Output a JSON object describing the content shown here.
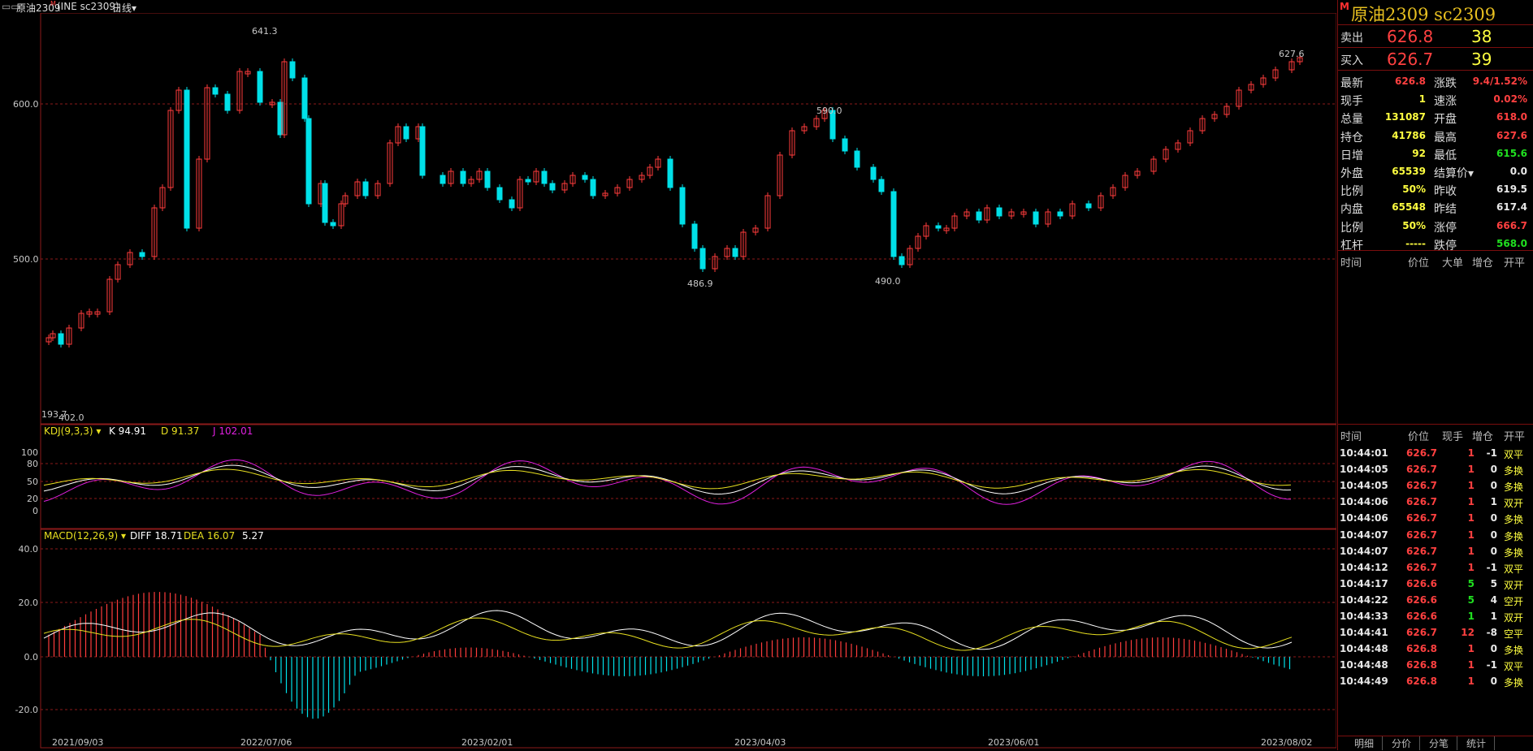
{
  "topbar": {
    "title": "原油2309",
    "exchange": "(INE sc2309)",
    "period": "日线",
    "period_arrow": "▾"
  },
  "main_chart": {
    "y_labels": [
      "600.0",
      "500.0"
    ],
    "annotations": {
      "high": "641.3",
      "mid_high": "590.0",
      "last_high": "627.6",
      "low1": "486.9",
      "low2": "490.0",
      "start_low": "193.7",
      "start_low2": "402.0"
    },
    "x_labels": [
      "2021/09/03",
      "2022/07/06",
      "2023/02/01",
      "2023/04/03",
      "2023/06/01",
      "2023/08/02"
    ]
  },
  "kdj": {
    "name": "KDJ(9,3,3)",
    "k": "K 94.91",
    "d": "D 91.37",
    "j": "J 102.01",
    "y_labels": [
      "100",
      "80",
      "50",
      "20",
      "0"
    ]
  },
  "macd": {
    "name": "MACD(12,26,9)",
    "diff": "DIFF 18.71",
    "dea": "DEA 16.07",
    "macd": "5.27",
    "y_labels": [
      "40.0",
      "20.0",
      "0.0",
      "-20.0"
    ]
  },
  "colors": {
    "up": "#ff3c3c",
    "down": "#00e0e8",
    "grid": "#8b1a1a",
    "k": "#ffffff",
    "d": "#e8e020",
    "j": "#e020e0"
  },
  "side": {
    "marker": "M",
    "title": "原油2309  sc2309",
    "sell": {
      "label": "卖出",
      "price": "626.8",
      "vol": "38"
    },
    "buy": {
      "label": "买入",
      "price": "626.7",
      "vol": "39"
    },
    "quote_rows": [
      {
        "l1": "最新",
        "v1": "626.8",
        "c1": "red",
        "l2": "涨跌",
        "v2": "9.4/1.52%",
        "c2": "red"
      },
      {
        "l1": "现手",
        "v1": "1",
        "c1": "yellow",
        "l2": "速涨",
        "v2": "0.02%",
        "c2": "red"
      },
      {
        "l1": "总量",
        "v1": "131087",
        "c1": "yellow",
        "l2": "开盘",
        "v2": "618.0",
        "c2": "red"
      },
      {
        "l1": "持仓",
        "v1": "41786",
        "c1": "yellow",
        "l2": "最高",
        "v2": "627.6",
        "c2": "red"
      },
      {
        "l1": "日增",
        "v1": "92",
        "c1": "yellow",
        "l2": "最低",
        "v2": "615.6",
        "c2": "green"
      },
      {
        "l1": "外盘",
        "v1": "65539",
        "c1": "yellow",
        "l2": "结算价▾",
        "v2": "0.0",
        "c2": "white"
      },
      {
        "l1": "比例",
        "v1": "50%",
        "c1": "yellow",
        "l2": "昨收",
        "v2": "619.5",
        "c2": "white"
      },
      {
        "l1": "内盘",
        "v1": "65548",
        "c1": "yellow",
        "l2": "昨结",
        "v2": "617.4",
        "c2": "white"
      },
      {
        "l1": "比例",
        "v1": "50%",
        "c1": "yellow",
        "l2": "涨停",
        "v2": "666.7",
        "c2": "red"
      },
      {
        "l1": "杠杆",
        "v1": "-----",
        "c1": "yellow",
        "l2": "跌停",
        "v2": "568.0",
        "c2": "green"
      }
    ],
    "big_header": [
      "时间",
      "价位",
      "大单",
      "增仓",
      "开平"
    ],
    "tick_header": [
      "时间",
      "价位",
      "现手",
      "增仓",
      "开平"
    ],
    "ticks": [
      [
        "10:44:01",
        "626.7",
        "1",
        "-1",
        "双平"
      ],
      [
        "10:44:05",
        "626.7",
        "1",
        "0",
        "多换"
      ],
      [
        "10:44:05",
        "626.7",
        "1",
        "0",
        "多换"
      ],
      [
        "10:44:06",
        "626.7",
        "1",
        "1",
        "双开"
      ],
      [
        "10:44:06",
        "626.7",
        "1",
        "0",
        "多换"
      ],
      [
        "10:44:07",
        "626.7",
        "1",
        "0",
        "多换"
      ],
      [
        "10:44:07",
        "626.7",
        "1",
        "0",
        "多换"
      ],
      [
        "10:44:12",
        "626.7",
        "1",
        "-1",
        "双平"
      ],
      [
        "10:44:17",
        "626.6",
        "5",
        "5",
        "双开"
      ],
      [
        "10:44:22",
        "626.6",
        "5",
        "4",
        "空开"
      ],
      [
        "10:44:33",
        "626.6",
        "1",
        "1",
        "双开"
      ],
      [
        "10:44:41",
        "626.7",
        "12",
        "-8",
        "空平"
      ],
      [
        "10:44:48",
        "626.8",
        "1",
        "0",
        "多换"
      ],
      [
        "10:44:48",
        "626.8",
        "1",
        "-1",
        "双平"
      ],
      [
        "10:44:49",
        "626.8",
        "1",
        "0",
        "多换"
      ]
    ],
    "tick_colors": [
      "red",
      "red",
      "red",
      "red",
      "red",
      "red",
      "red",
      "red",
      "red",
      "red",
      "red",
      "red",
      "red",
      "red",
      "red"
    ],
    "tick_vol_colors": [
      "red",
      "red",
      "red",
      "red",
      "red",
      "red",
      "red",
      "red",
      "green",
      "green",
      "green",
      "red",
      "red",
      "red",
      "red"
    ],
    "tabs": [
      "明细",
      "分价",
      "分笔",
      "统计"
    ]
  }
}
